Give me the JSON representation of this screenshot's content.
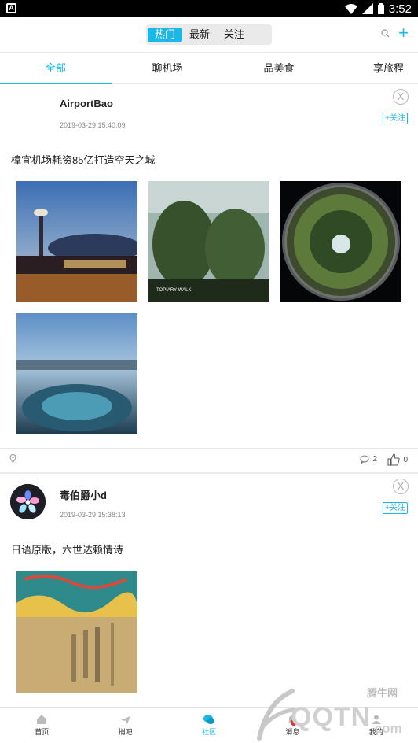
{
  "status_bar": {
    "time": "3:52",
    "app_badge": "A"
  },
  "header": {
    "segments": [
      {
        "label": "热门",
        "active": true
      },
      {
        "label": "最新",
        "active": false
      },
      {
        "label": "关注",
        "active": false
      }
    ],
    "search_icon": "search-icon",
    "add_icon": "plus-icon"
  },
  "tabs": [
    {
      "label": "全部",
      "active": true
    },
    {
      "label": "聊机场",
      "active": false
    },
    {
      "label": "品美食",
      "active": false
    },
    {
      "label": "享旅程",
      "active": false
    }
  ],
  "posts": [
    {
      "username": "AirportBao",
      "time": "2019-03-29 15:40:09",
      "follow_label": "+关注",
      "close_label": "X",
      "text": "樟宜机场耗资85亿打造空天之城",
      "image_count": 4,
      "comments": "2",
      "likes": "0"
    },
    {
      "username": "毒伯爵小d",
      "time": "2019-03-29 15:38:13",
      "follow_label": "+关注",
      "close_label": "X",
      "text": "日语原版，六世达赖情诗",
      "image_count": 1
    }
  ],
  "bottom_nav": [
    {
      "label": "首页",
      "icon": "home-icon",
      "active": false
    },
    {
      "label": "捎吧",
      "icon": "plane-icon",
      "active": false
    },
    {
      "label": "社区",
      "icon": "chat-icon",
      "active": true
    },
    {
      "label": "消息",
      "icon": "bell-icon",
      "active": false
    },
    {
      "label": "我的",
      "icon": "user-icon",
      "active": false
    }
  ],
  "watermark": {
    "brand": "QQTN",
    "suffix": ".com",
    "cn": "腾牛网"
  },
  "colors": {
    "accent": "#1ab8e8"
  }
}
